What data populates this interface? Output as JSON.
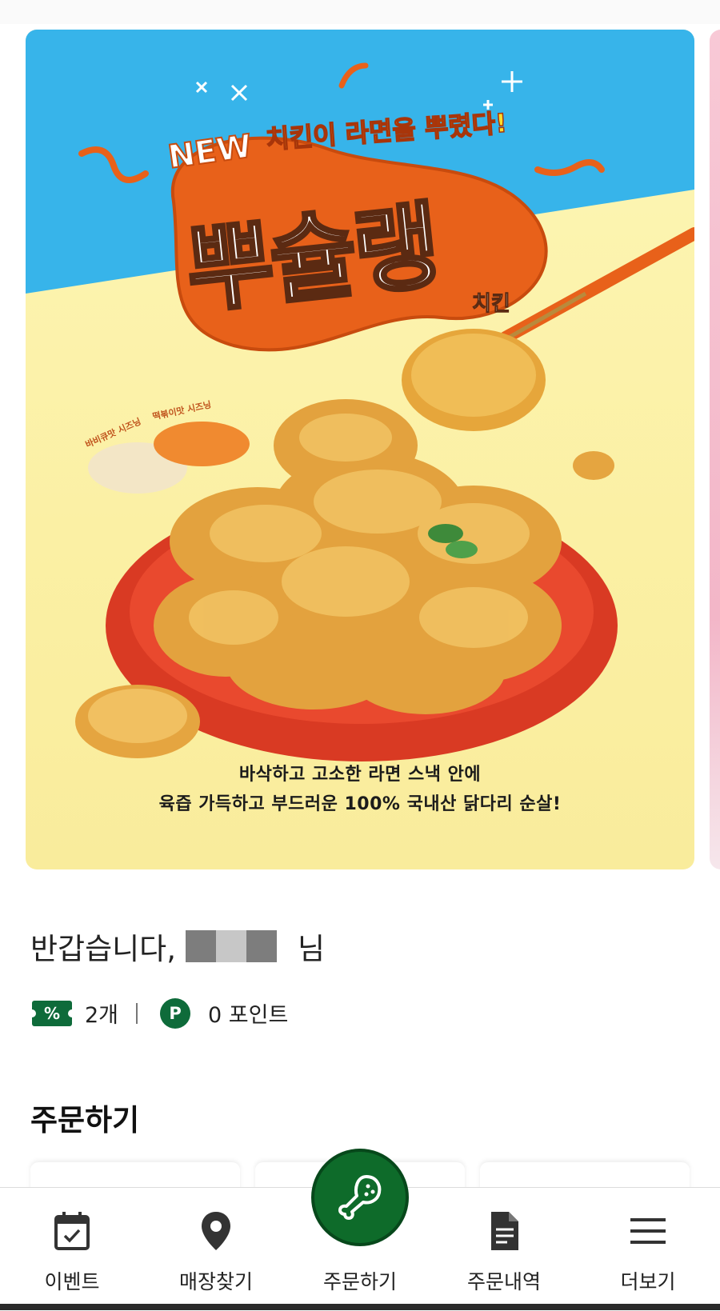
{
  "banner": {
    "tag": "NEW",
    "headline": "치킨이 라면을 뿌렸다!",
    "product_name": "뿌슐랭",
    "product_suffix": "치킨",
    "seasoning_left": "바비큐맛 시즈닝",
    "seasoning_right": "떡볶이맛 시즈닝",
    "description_line1": "바삭하고 고소한 라면 스낵 안에",
    "description_line2": "육즙 가득하고 부드러운 100% 국내산 닭다리 순살!"
  },
  "greeting": {
    "prefix": "반갑습니다,",
    "suffix": "님"
  },
  "benefits": {
    "coupon_symbol": "%",
    "coupon_count": "2개",
    "point_symbol": "P",
    "points": "0 포인트"
  },
  "order_section": {
    "title": "주문하기"
  },
  "nav": {
    "items": [
      {
        "label": "이벤트",
        "icon": "calendar-check-icon"
      },
      {
        "label": "매장찾기",
        "icon": "map-pin-icon"
      },
      {
        "label": "주문하기",
        "icon": "chicken-leg-icon"
      },
      {
        "label": "주문내역",
        "icon": "document-icon"
      },
      {
        "label": "더보기",
        "icon": "menu-icon"
      }
    ]
  },
  "colors": {
    "brand_green": "#0e6b3a",
    "banner_sky": "#37b4ea",
    "banner_orange": "#e8611a"
  }
}
